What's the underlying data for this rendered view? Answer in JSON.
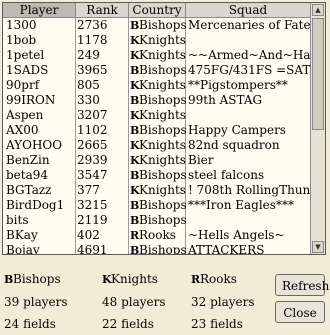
{
  "headers": {
    "player": "Player",
    "rank": "Rank",
    "country": "Country",
    "squad": "Squad"
  },
  "rows": [
    {
      "player": "1300",
      "rank": "2736",
      "flag": "B",
      "country": "Bishops",
      "squad": "Mercenaries of Fate"
    },
    {
      "player": "1bob",
      "rank": "1178",
      "flag": "K",
      "country": "Knights",
      "squad": ""
    },
    {
      "player": "1petel",
      "rank": "249",
      "flag": "K",
      "country": "Knights",
      "squad": "~~Armed~And~Hammer"
    },
    {
      "player": "1SADS",
      "rank": "3965",
      "flag": "B",
      "country": "Bishops",
      "squad": "475FG/431FS =SATANS"
    },
    {
      "player": "90prf",
      "rank": "805",
      "flag": "K",
      "country": "Knights",
      "squad": "**Pigstompers**"
    },
    {
      "player": "99IRON",
      "rank": "330",
      "flag": "B",
      "country": "Bishops",
      "squad": "99th ASTAG"
    },
    {
      "player": "Aspen",
      "rank": "3207",
      "flag": "K",
      "country": "Knights",
      "squad": ""
    },
    {
      "player": "AX00",
      "rank": "1102",
      "flag": "B",
      "country": "Bishops",
      "squad": "Happy Campers"
    },
    {
      "player": "AYOHOO",
      "rank": "2665",
      "flag": "K",
      "country": "Knights",
      "squad": "82nd squadron"
    },
    {
      "player": "BenZin",
      "rank": "2939",
      "flag": "K",
      "country": "Knights",
      "squad": "Bier"
    },
    {
      "player": "beta94",
      "rank": "3547",
      "flag": "B",
      "country": "Bishops",
      "squad": "steel falcons"
    },
    {
      "player": "BGTazz",
      "rank": "377",
      "flag": "K",
      "country": "Knights",
      "squad": "! 708th RollingThunder !"
    },
    {
      "player": "BirdDog1",
      "rank": "3215",
      "flag": "B",
      "country": "Bishops",
      "squad": "***Iron Eagles***"
    },
    {
      "player": "bits",
      "rank": "2119",
      "flag": "B",
      "country": "Bishops",
      "squad": ""
    },
    {
      "player": "BKay",
      "rank": "402",
      "flag": "R",
      "country": "Rooks",
      "squad": "~Hells Angels~"
    },
    {
      "player": "Bojay",
      "rank": "4691",
      "flag": "B",
      "country": "Bishops",
      "squad": "ATTACKERS"
    }
  ],
  "summary": {
    "bishops": {
      "flag": "B",
      "name": "Bishops",
      "players": "39 players",
      "fields": "24 fields"
    },
    "knights": {
      "flag": "K",
      "name": "Knights",
      "players": "48 players",
      "fields": "22 fields"
    },
    "rooks": {
      "flag": "R",
      "name": "Rooks",
      "players": "32 players",
      "fields": "23 fields"
    }
  },
  "buttons": {
    "refresh": "Refresh",
    "close": "Close"
  },
  "icons": {
    "bishops": "bishops-flag-icon",
    "knights": "knights-flag-icon",
    "rooks": "rooks-flag-icon"
  },
  "colors": {
    "background": "#f2ecd6",
    "list_background": "#fffcf0",
    "header": "#d9d6cc"
  }
}
